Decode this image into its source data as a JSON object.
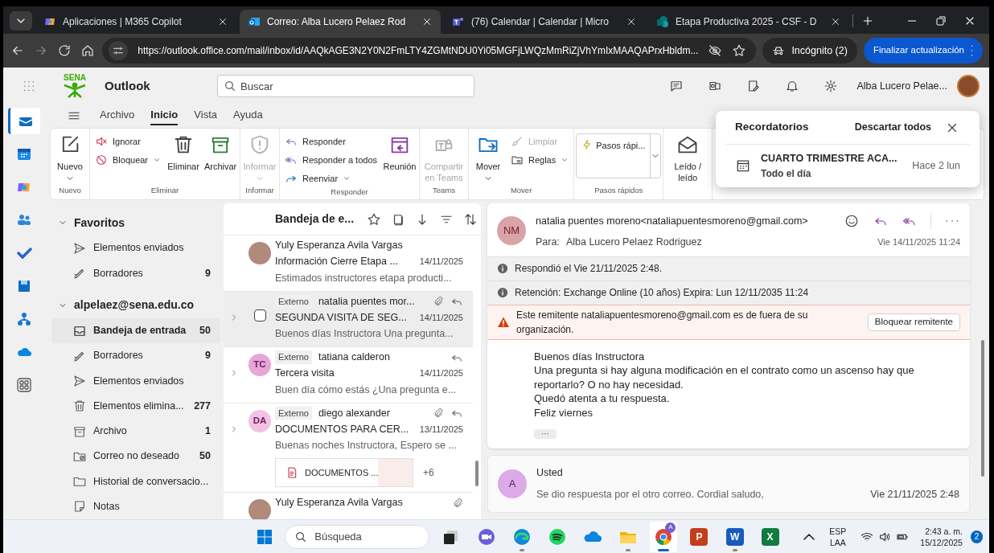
{
  "browser": {
    "tabs": [
      {
        "title": "Aplicaciones | M365 Copilot",
        "selected": false
      },
      {
        "title": "Correo: Alba Lucero Pelaez Rod",
        "selected": true
      },
      {
        "title": "(76) Calendar | Calendar | Micro",
        "selected": false
      },
      {
        "title": "Etapa Productiva 2025 - CSF - D",
        "selected": false
      }
    ],
    "url": "https://outlook.office.com/mail/inbox/id/AAQkAGE3N2Y0N2FmLTY4ZGMtNDU0Yi05MGFjLWQzMmRiZjVhYmIxMAAQAPrxHbldm...",
    "incognito": "Incógnito (2)",
    "update_button": "Finalizar actualización"
  },
  "header": {
    "logo_text": "SENA",
    "app_name": "Outlook",
    "search": {
      "placeholder": "Buscar"
    },
    "user_name": "Alba Lucero Pelae..."
  },
  "menu_tabs": [
    {
      "label": "Archivo",
      "selected": false
    },
    {
      "label": "Inicio",
      "selected": true
    },
    {
      "label": "Vista",
      "selected": false
    },
    {
      "label": "Ayuda",
      "selected": false
    }
  ],
  "ribbon": [
    {
      "label": "Nuevo",
      "buttons": [
        {
          "kind": "large",
          "label": "Nuevo",
          "dropdown": true,
          "disabled": false
        }
      ]
    },
    {
      "label": "Eliminar",
      "buttons": [
        {
          "kind": "small",
          "label": "Ignorar",
          "dropdown": false,
          "disabled": false
        },
        {
          "kind": "small",
          "label": "Bloquear",
          "dropdown": true,
          "disabled": false
        },
        {
          "kind": "large",
          "label": "Eliminar",
          "dropdown": false,
          "disabled": false
        },
        {
          "kind": "large",
          "label": "Archivar",
          "dropdown": false,
          "disabled": false
        }
      ]
    },
    {
      "label": "Informar",
      "buttons": [
        {
          "kind": "large",
          "label": "Informar",
          "dropdown": true,
          "disabled": true
        }
      ]
    },
    {
      "label": "Responder",
      "buttons": [
        {
          "kind": "small",
          "label": "Responder",
          "dropdown": false,
          "disabled": false
        },
        {
          "kind": "small",
          "label": "Responder a todos",
          "dropdown": false,
          "disabled": false
        },
        {
          "kind": "small",
          "label": "Reenviar",
          "dropdown": true,
          "disabled": false
        },
        {
          "kind": "large",
          "label": "Reunión",
          "dropdown": false,
          "disabled": false
        }
      ]
    },
    {
      "label": "Teams",
      "buttons": [
        {
          "kind": "large",
          "label": "Compartir en Teams",
          "dropdown": false,
          "disabled": true
        }
      ]
    },
    {
      "label": "Mover",
      "buttons": [
        {
          "kind": "large",
          "label": "Mover",
          "dropdown": true,
          "disabled": false
        },
        {
          "kind": "small",
          "label": "Limpiar",
          "dropdown": false,
          "disabled": true
        },
        {
          "kind": "small",
          "label": "Reglas",
          "dropdown": true,
          "disabled": false
        }
      ]
    },
    {
      "label": "Pasos rápidos",
      "buttons": [
        {
          "kind": "gallery",
          "label": "Pasos rápi...",
          "dropdown": true,
          "disabled": false
        }
      ]
    },
    {
      "buttons": [
        {
          "kind": "large",
          "label": "Leído / leído",
          "dropdown": false,
          "disabled": false
        }
      ]
    }
  ],
  "reminders": {
    "title": "Recordatorios",
    "dismiss_all": "Descartar todos",
    "items": [
      {
        "title": "CUARTO TRIMESTRE ACA...",
        "subtitle": "Todo el día",
        "time": "Hace 2 lun"
      }
    ]
  },
  "rail": [
    {
      "selected": true
    },
    {
      "selected": false
    },
    {
      "selected": false
    },
    {
      "selected": false
    },
    {
      "selected": false
    },
    {
      "selected": false
    },
    {
      "selected": false
    },
    {
      "selected": false
    },
    {
      "selected": false
    }
  ],
  "folders": [
    {
      "title": "Favoritos",
      "expanded": true,
      "items": [
        {
          "name": "Elementos enviados",
          "selected": false
        },
        {
          "name": "Borradores",
          "count": "9",
          "selected": false
        }
      ]
    },
    {
      "title": "alpelaez@sena.edu.co",
      "expanded": true,
      "items": [
        {
          "name": "Bandeja de entrada",
          "count": "50",
          "selected": true
        },
        {
          "name": "Borradores",
          "count": "9",
          "selected": false
        },
        {
          "name": "Elementos enviados",
          "selected": false
        },
        {
          "name": "Elementos elimina...",
          "count": "277",
          "selected": false
        },
        {
          "name": "Archivo",
          "count": "1",
          "selected": false
        },
        {
          "name": "Correo no deseado",
          "count": "50",
          "selected": false
        },
        {
          "name": "Historial de conversacio...",
          "selected": false
        },
        {
          "name": "Notas",
          "selected": false
        }
      ]
    }
  ],
  "message_list": {
    "title": "Bandeja de e...",
    "messages": [
      {
        "sender": "Yuly Esperanza Avila Vargas",
        "subject": "Información Cierre Etapa ...",
        "date": "14/11/2025",
        "preview": "Estimados instructores etapa producti...",
        "external": false,
        "thread": false,
        "attachment": false,
        "replied": false,
        "selected": false
      },
      {
        "external_label": "Externo",
        "sender": "natalia puentes mor...",
        "subject": "SEGUNDA VISITA DE SEG...",
        "date": "14/11/2025",
        "preview": "Buenos días Instructora Una pregunta...",
        "external": true,
        "thread": true,
        "attachment": true,
        "replied": true,
        "selected": true
      },
      {
        "initials": "TC",
        "color": "#e8a6d8",
        "external_label": "Externo",
        "sender": "tatiana calderon",
        "subject": "Tercera visita",
        "date": "14/11/2025",
        "preview": "Buen día cómo estás ¿Una pregunta e...",
        "external": true,
        "thread": true,
        "attachment": false,
        "replied": true,
        "selected": false
      },
      {
        "initials": "DA",
        "color": "#f3c1e3",
        "external_label": "Externo",
        "sender": "diego alexander",
        "subject": "DOCUMENTOS PARA CER...",
        "date": "13/11/2025",
        "preview": "Buenas noches Instructora, Espero se ...",
        "external": true,
        "thread": true,
        "attachment": true,
        "replied": true,
        "selected": false,
        "attachment_chip": {
          "name": "DOCUMENTOS ...",
          "more": "+6"
        }
      },
      {
        "sender": "Yuly Esperanza Avila Vargas",
        "external": false,
        "thread": false,
        "attachment": true,
        "replied": false,
        "selected": false
      }
    ]
  },
  "reading_pane": {
    "message": {
      "initials": "NM",
      "from": "natalia puentes moreno<nataliapuentesmoreno@gmail.com>",
      "to_label": "Para:",
      "to": "Alba Lucero Pelaez Rodriguez",
      "date": "Vie 14/11/2025 11:24",
      "notices": [
        {
          "kind": "info",
          "text": "Respondió el Vie 21/11/2025 2:48."
        },
        {
          "kind": "info",
          "text": "Retención: Exchange Online (10 años) Expira: Lun 12/11/2035 11:24"
        },
        {
          "kind": "warning",
          "text": "Este remitente nataliapuentesmoreno@gmail.com es de fuera de su organización.",
          "button": "Bloquear remitente"
        }
      ],
      "body": [
        "Buenos días Instructora",
        "Una pregunta si hay alguna modificación en el contrato como un ascenso hay que reportarlo? O no hay necesidad.",
        "Quedó atenta a tu respuesta.",
        "Feliz viernes"
      ],
      "more": "···"
    },
    "reply": {
      "initials": "A",
      "sender": "Usted",
      "preview": "Se dio respuesta por el otro correo. Cordial saludo,",
      "date": "Vie 21/11/2025 2:48"
    }
  },
  "taskbar": {
    "search": {
      "placeholder": "Búsqueda"
    },
    "apps": [
      {
        "running": false,
        "active": false
      },
      {
        "running": false,
        "active": false
      },
      {
        "running": true,
        "active": false
      },
      {
        "running": false,
        "active": false
      },
      {
        "running": false,
        "active": false
      },
      {
        "running": true,
        "active": false
      },
      {
        "badge": "A",
        "running": true,
        "active": true
      },
      {
        "glyph": "P",
        "color": "#c43e1c",
        "running": false,
        "active": false
      },
      {
        "glyph": "W",
        "color": "#185abd",
        "running": true,
        "active": false
      },
      {
        "glyph": "X",
        "color": "#107c41",
        "running": false,
        "active": false
      }
    ],
    "language": "ESP",
    "layout": "LAA",
    "time": "2:43 a. m.",
    "date": "15/12/2025",
    "notifications": "2"
  }
}
